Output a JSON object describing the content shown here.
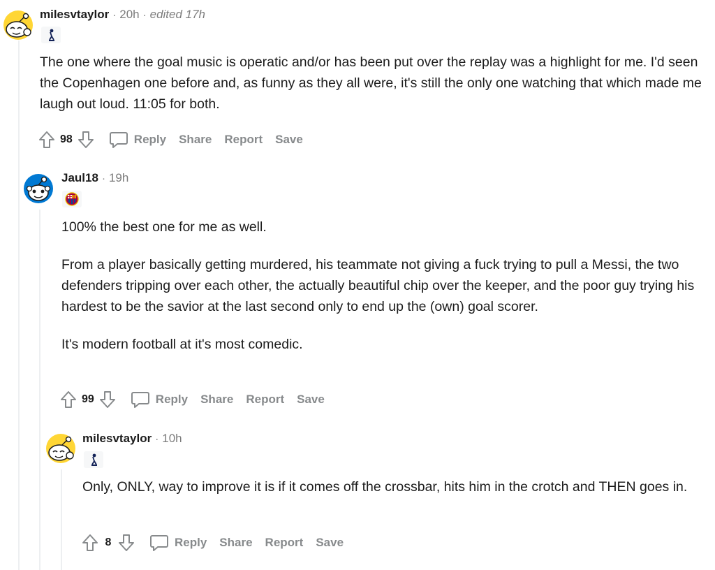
{
  "comments": [
    {
      "username": "milesvtaylor",
      "time": "20h",
      "edited": "edited 17h",
      "flair": "spurs-crest",
      "paragraphs": [
        "The one where the goal music is operatic and/or has been put over the replay was a highlight for me. I'd seen the Copenhagen one before and, as funny as they all were, it's still the only one watching that which made me laugh out loud. 11:05 for both."
      ],
      "score": "98",
      "actions": {
        "reply": "Reply",
        "share": "Share",
        "report": "Report",
        "save": "Save"
      }
    },
    {
      "username": "Jaul18",
      "time": "19h",
      "flair": "barcelona-crest",
      "paragraphs": [
        "100% the best one for me as well.",
        "From a player basically getting murdered, his teammate not giving a fuck trying to pull a Messi, the two defenders tripping over each other, the actually beautiful chip over the keeper, and the poor guy trying his hardest to be the savior at the last second only to end up the (own) goal scorer.",
        "It's modern football at it's most comedic."
      ],
      "score": "99",
      "actions": {
        "reply": "Reply",
        "share": "Share",
        "report": "Report",
        "save": "Save"
      }
    },
    {
      "username": "milesvtaylor",
      "time": "10h",
      "flair": "spurs-crest",
      "paragraphs": [
        "Only, ONLY, way to improve it is if it comes off the crossbar, hits him in the crotch and THEN goes in."
      ],
      "score": "8",
      "actions": {
        "reply": "Reply",
        "share": "Share",
        "report": "Report",
        "save": "Save"
      }
    }
  ],
  "colors": {
    "action_grey": "#878a8c",
    "thread_line": "#edeff1",
    "avatar_yellow": "#ffd635",
    "avatar_blue": "#0079d3"
  }
}
